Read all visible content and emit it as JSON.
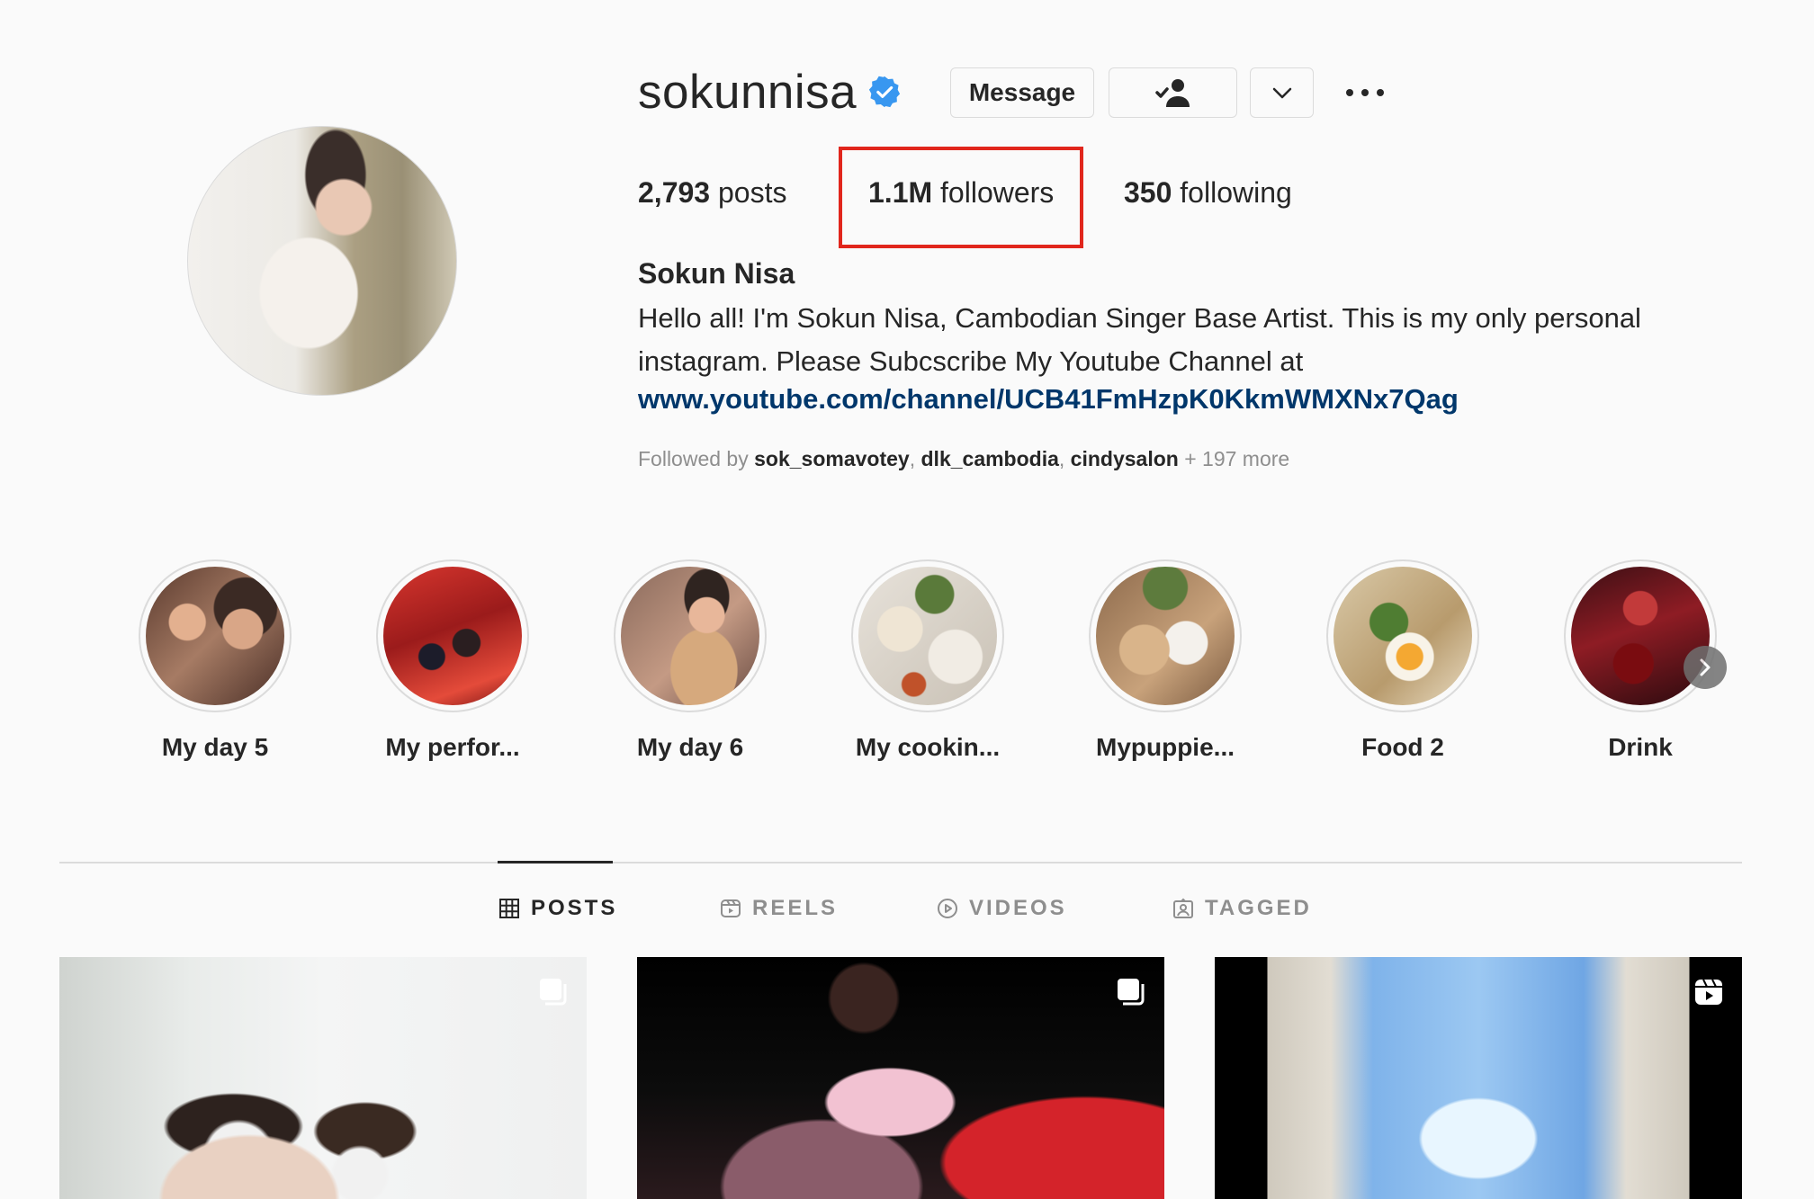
{
  "profile": {
    "username": "sokunnisa",
    "verified": true,
    "full_name": "Sokun Nisa",
    "bio_line1": "Hello all! I'm Sokun Nisa, Cambodian Singer Base Artist. This is my only personal",
    "bio_line2": "instagram. Please Subcscribe My Youtube Channel at",
    "bio_link": "www.youtube.com/channel/UCB41FmHzpK0KkmWMXNx7Qag",
    "followed_by_prefix": "Followed by",
    "followed_by": [
      "sok_somavotey",
      "dlk_cambodia",
      "cindysalon"
    ],
    "followed_by_more": "+ 197 more"
  },
  "actions": {
    "message_label": "Message",
    "follow_icon": "user-check-icon",
    "dropdown_icon": "chevron-down-icon",
    "more_icon": "more-horizontal-icon"
  },
  "stats": {
    "posts_count": "2,793",
    "posts_label": "posts",
    "followers_count": "1.1M",
    "followers_label": "followers",
    "following_count": "350",
    "following_label": "following"
  },
  "highlights": [
    {
      "label": "My day 5"
    },
    {
      "label": "My perfor..."
    },
    {
      "label": "My day 6"
    },
    {
      "label": "My cookin..."
    },
    {
      "label": "Mypuppie..."
    },
    {
      "label": "Food 2"
    },
    {
      "label": "Drink"
    }
  ],
  "tabs": [
    {
      "label": "POSTS",
      "icon": "grid-icon",
      "active": true
    },
    {
      "label": "REELS",
      "icon": "reels-icon",
      "active": false
    },
    {
      "label": "VIDEOS",
      "icon": "play-icon",
      "active": false
    },
    {
      "label": "TAGGED",
      "icon": "tagged-icon",
      "active": false
    }
  ],
  "posts": [
    {
      "type": "carousel",
      "icon": "carousel-icon"
    },
    {
      "type": "carousel",
      "icon": "carousel-icon"
    },
    {
      "type": "reel",
      "icon": "reels-icon"
    }
  ],
  "colors": {
    "verified_blue": "#3897f0",
    "link_blue": "#00376b",
    "highlight_red": "#e1261c",
    "text_primary": "#262626",
    "text_secondary": "#8e8e8e",
    "background": "#fafafa"
  }
}
